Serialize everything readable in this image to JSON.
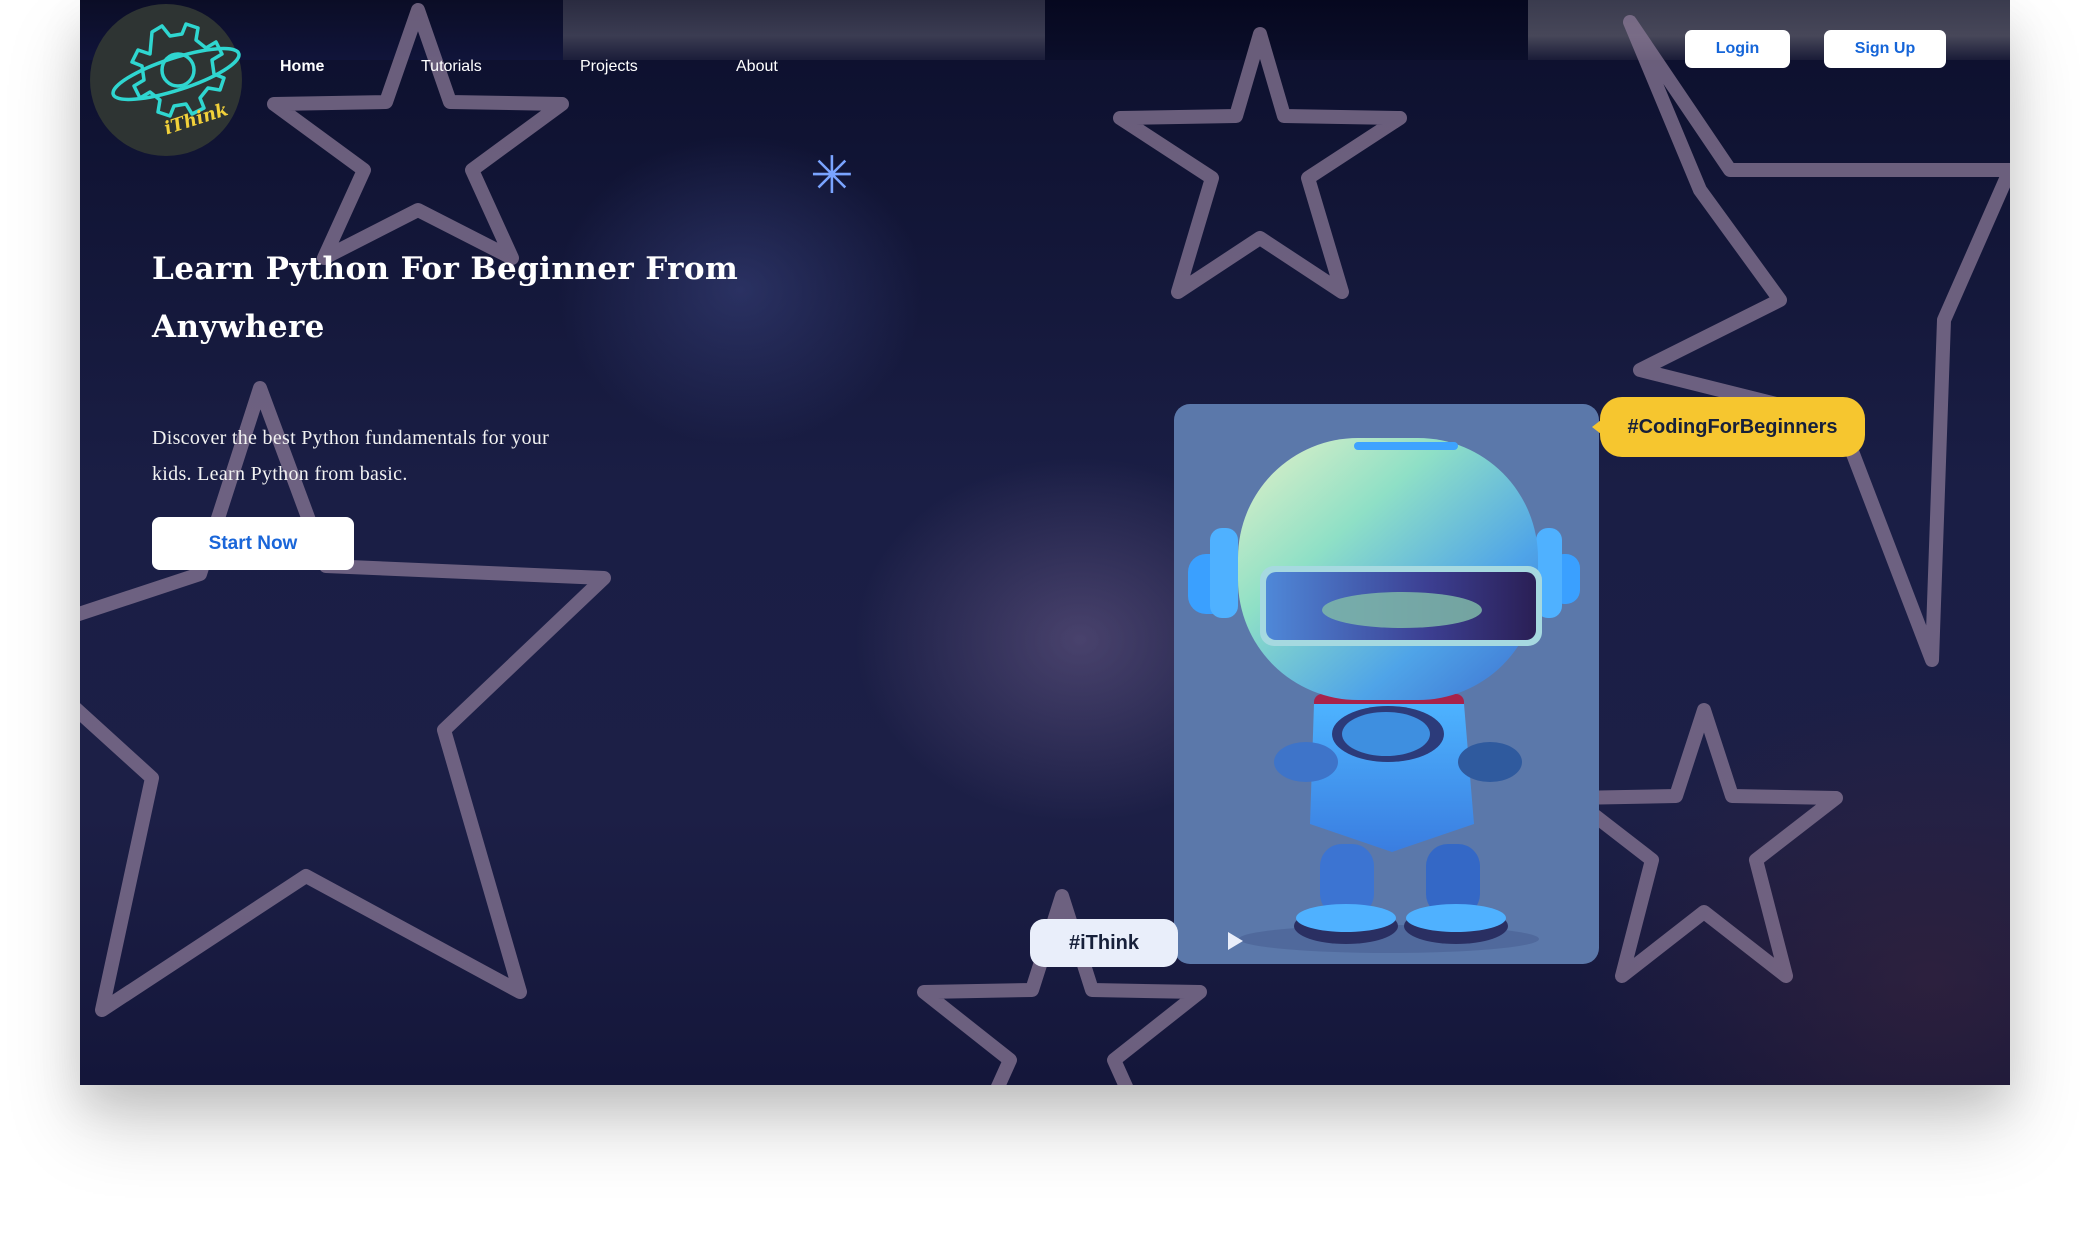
{
  "brand": {
    "logo_text": "iThink"
  },
  "nav": {
    "items": [
      {
        "label": "Home",
        "active": true
      },
      {
        "label": "Tutorials",
        "active": false
      },
      {
        "label": "Projects",
        "active": false
      },
      {
        "label": "About",
        "active": false
      }
    ]
  },
  "auth": {
    "login_label": "Login",
    "signup_label": "Sign Up"
  },
  "hero": {
    "headline": "Learn Python For Beginner From Anywhere",
    "subtext": "Discover the best Python fundamentals for your kids. Learn Python from basic.",
    "cta_label": "Start Now"
  },
  "decor": {
    "asterisk_glyph": "✳"
  },
  "showcase": {
    "tag_primary": "#CodingForBeginners",
    "tag_secondary": "#iThink"
  },
  "colors": {
    "background": "#1a1e45",
    "accent_blue": "#1565d8",
    "tag_yellow": "#f6c62f",
    "card_blue": "#5b78aa",
    "star_outline": "#8a7896"
  },
  "icons": {
    "asterisk": "asterisk-icon",
    "play": "play-icon",
    "logo": "gear-planet-logo-icon"
  }
}
